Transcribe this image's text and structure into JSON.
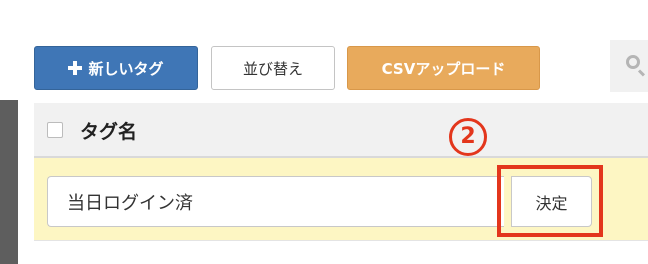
{
  "toolbar": {
    "new_tag_label": "新しいタグ",
    "sort_label": "並び替え",
    "csv_upload_label": "CSVアップロード"
  },
  "table": {
    "header_label": "タグ名",
    "edit_row": {
      "input_value": "当日ログイン済",
      "confirm_label": "決定"
    }
  },
  "annotation": {
    "step_number": "2"
  },
  "colors": {
    "primary": "#3f76b6",
    "csv_button": "#e8aa5c",
    "highlight_row": "#fdf6c3",
    "annotation": "#e3361c"
  }
}
